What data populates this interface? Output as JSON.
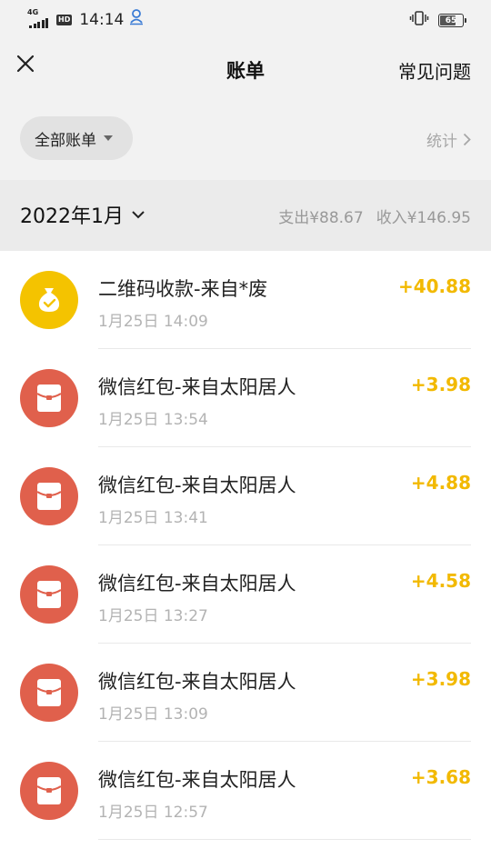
{
  "status_bar": {
    "network": "4G",
    "hd": "HD",
    "time": "14:14",
    "battery": "65"
  },
  "nav": {
    "title": "账单",
    "faq_label": "常见问题"
  },
  "filter": {
    "all_bills_label": "全部账单",
    "stats_label": "统计"
  },
  "month": {
    "label": "2022年1月",
    "expense": "支出¥88.67",
    "income": "收入¥146.95"
  },
  "transactions": [
    {
      "icon": "money-bag-icon",
      "title": "二维码收款-来自*废",
      "time": "1月25日 14:09",
      "amount": "+40.88"
    },
    {
      "icon": "red-packet-icon",
      "title": "微信红包-来自太阳居人",
      "time": "1月25日 13:54",
      "amount": "+3.98"
    },
    {
      "icon": "red-packet-icon",
      "title": "微信红包-来自太阳居人",
      "time": "1月25日 13:41",
      "amount": "+4.88"
    },
    {
      "icon": "red-packet-icon",
      "title": "微信红包-来自太阳居人",
      "time": "1月25日 13:27",
      "amount": "+4.58"
    },
    {
      "icon": "red-packet-icon",
      "title": "微信红包-来自太阳居人",
      "time": "1月25日 13:09",
      "amount": "+3.98"
    },
    {
      "icon": "red-packet-icon",
      "title": "微信红包-来自太阳居人",
      "time": "1月25日 12:57",
      "amount": "+3.68"
    }
  ],
  "colors": {
    "amount": "#f2b900",
    "qr_icon_bg": "#f4c300",
    "red_packet_bg": "#e0604c",
    "header_bg": "#f2f2f2"
  }
}
